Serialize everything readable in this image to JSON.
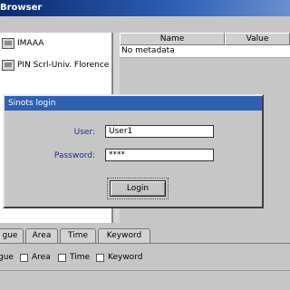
{
  "window": {
    "title": "Browser"
  },
  "tree": {
    "items": [
      {
        "label": "IMAAA"
      },
      {
        "label": "PIN Scrl-Univ. Florence"
      }
    ]
  },
  "table": {
    "columns": [
      "Name",
      "Value"
    ],
    "rows": [
      {
        "name": "No metadata",
        "value": ""
      }
    ]
  },
  "login_dialog": {
    "title": "Sinots login",
    "user_label": "User:",
    "user_value": "User1",
    "password_label": "Password:",
    "password_value": "****",
    "login_button": "Login"
  },
  "tabs": [
    "gue",
    "Area",
    "Time",
    "Keyword"
  ],
  "checkboxes": [
    "gue",
    "Area",
    "Time",
    "Keyword"
  ]
}
